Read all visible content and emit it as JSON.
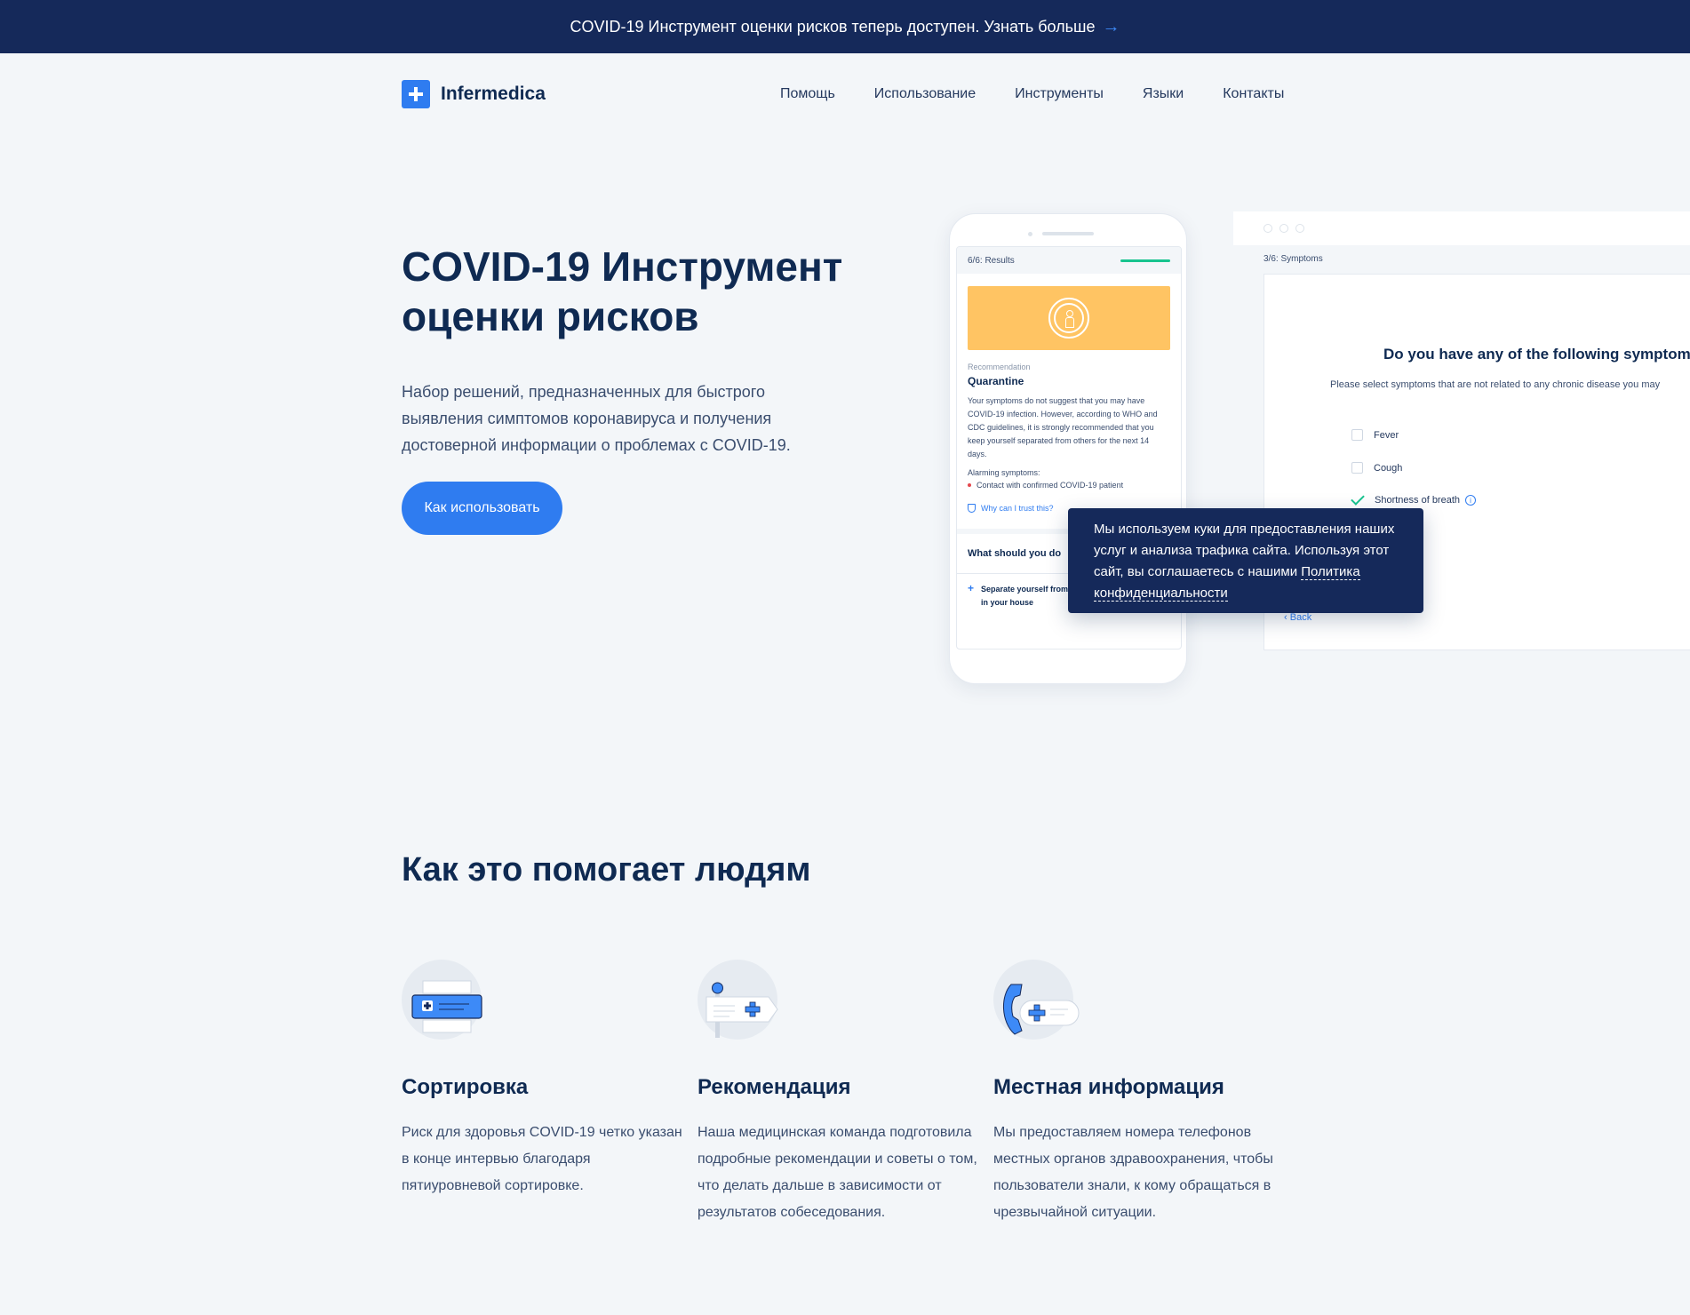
{
  "topbar": {
    "message": "COVID-19 Инструмент оценки рисков теперь доступен. Узнать больше",
    "arrow_icon": "arrow-right-icon"
  },
  "header": {
    "logo_text": "Infermedica",
    "nav": [
      "Помощь",
      "Использование",
      "Инструменты",
      "Языки",
      "Контакты"
    ]
  },
  "hero": {
    "title_line1": "COVID-19 Инструмент",
    "title_line2": "оценки рисков",
    "description": "Набор решений, предназначенных для быстрого выявления симптомов коронавируса и получения достоверной информации о проблемах с COVID-19.",
    "button_label": "Как использовать"
  },
  "phone_mockup": {
    "step": "6/6: Results",
    "recommendation_label": "Recommendation",
    "recommendation_title": "Quarantine",
    "recommendation_text": "Your symptoms do not suggest that you may have COVID-19 infection. However, according to WHO and CDC guidelines, it is strongly recommended that you keep yourself separated from others for the next 14 days.",
    "alarming_label": "Alarming symptoms:",
    "alarming_item": "Contact with confirmed COVID-19 patient",
    "trust_link": "Why can I trust this?",
    "what_title": "What should you do",
    "what_item": "Separate yourself from other people and animals in your house"
  },
  "desktop_mockup": {
    "step": "3/6: Symptoms",
    "question": "Do you have any of the following symptoms",
    "hint": "Please select symptoms that are not related to any chronic disease you may",
    "options": [
      {
        "label": "Fever",
        "checked": false
      },
      {
        "label": "Cough",
        "checked": false
      },
      {
        "label": "Shortness of breath",
        "checked": true
      }
    ],
    "back_label": "Back"
  },
  "cookie": {
    "text": "Мы используем куки для предоставления наших услуг и анализа трафика сайта. Используя этот сайт, вы соглашаетесь с нашими",
    "link": "Политика конфиденциальности"
  },
  "section": {
    "title": "Как это помогает людям",
    "features": [
      {
        "title": "Сортировка",
        "text": "Риск для здоровья COVID-19 четко указан в конце интервью благодаря пятиуровневой сортировке.",
        "icon": "triage-icon"
      },
      {
        "title": "Рекомендация",
        "text": "Наша медицинская команда подготовила подробные рекомендации и советы о том, что делать дальше в зависимости от результатов собеседования.",
        "icon": "recommendation-sign-icon"
      },
      {
        "title": "Местная информация",
        "text": "Мы предоставляем номера телефонов местных органов здравоохранения, чтобы пользователи знали, к кому обращаться в чрезвычайной ситуации.",
        "icon": "phone-help-icon"
      }
    ]
  },
  "colors": {
    "primary": "#2f7cf0",
    "navy": "#15295a",
    "background": "#f3f6f9",
    "warning": "#ffc463",
    "success": "#18c48f"
  }
}
